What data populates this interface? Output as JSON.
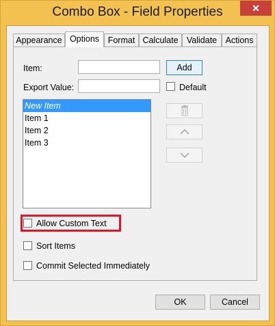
{
  "window": {
    "title": "Combo Box - Field Properties",
    "close_glyph": "✕"
  },
  "tabs": [
    "Appearance",
    "Options",
    "Format",
    "Calculate",
    "Validate",
    "Actions"
  ],
  "options": {
    "item_label": "Item:",
    "item_value": "",
    "add_label": "Add",
    "export_label": "Export Value:",
    "export_value": "",
    "default_label": "Default",
    "list_items": [
      "New Item",
      "Item 1",
      "Item 2",
      "Item 3"
    ],
    "selected_index": 0,
    "delete_icon": "trash-icon",
    "move_up_icon": "chevron-up-icon",
    "move_down_icon": "chevron-down-icon",
    "allow_custom_text_label": "Allow Custom Text",
    "sort_items_label": "Sort Items",
    "commit_label": "Commit Selected Immediately"
  },
  "footer": {
    "ok_label": "OK",
    "cancel_label": "Cancel"
  },
  "colors": {
    "title_bar": "#f3c14f",
    "close_button": "#c7413a",
    "selection": "#3399ff",
    "highlight": "#e0152b"
  }
}
